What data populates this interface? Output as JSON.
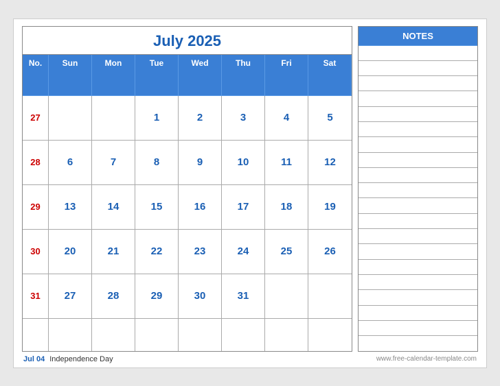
{
  "calendar": {
    "title": "July 2025",
    "headers": [
      "No.",
      "Sun",
      "Mon",
      "Tue",
      "Wed",
      "Thu",
      "Fri",
      "Sat"
    ],
    "weeks": [
      {
        "week_num": "27",
        "days": [
          "",
          "",
          "1",
          "2",
          "3",
          "4",
          "5"
        ]
      },
      {
        "week_num": "28",
        "days": [
          "6",
          "7",
          "8",
          "9",
          "10",
          "11",
          "12"
        ]
      },
      {
        "week_num": "29",
        "days": [
          "13",
          "14",
          "15",
          "16",
          "17",
          "18",
          "19"
        ]
      },
      {
        "week_num": "30",
        "days": [
          "20",
          "21",
          "22",
          "23",
          "24",
          "25",
          "26"
        ]
      },
      {
        "week_num": "31",
        "days": [
          "27",
          "28",
          "29",
          "30",
          "31",
          "",
          ""
        ]
      },
      {
        "week_num": "",
        "days": [
          "",
          "",
          "",
          "",
          "",
          "",
          ""
        ]
      }
    ]
  },
  "notes": {
    "header": "NOTES",
    "line_count": 20
  },
  "footer": {
    "holiday_date": "Jul 04",
    "holiday_name": "Independence Day",
    "url": "www.free-calendar-template.com"
  }
}
